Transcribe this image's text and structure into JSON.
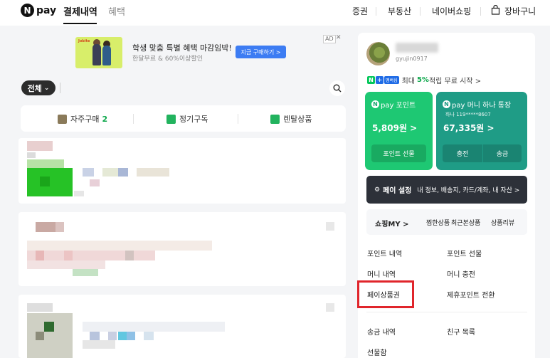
{
  "nav": {
    "logo_letter": "N",
    "logo_text": "pay",
    "tabs": [
      {
        "label": "결제내역",
        "active": true
      },
      {
        "label": "혜택",
        "active": false
      }
    ],
    "right": [
      "증권",
      "부동산",
      "네이버쇼핑",
      "장바구니"
    ]
  },
  "ad": {
    "brand": "Jobite",
    "title": "학생 맞춤 특별 혜택 마감임박!",
    "subtitle": "한달무료 & 60%이상할인",
    "button": "지금 구매하기 >",
    "tag": "AD",
    "close": "✕"
  },
  "filter": {
    "label": "전체",
    "chevron": "⌄"
  },
  "categories": [
    {
      "label": "자주구매",
      "count": "2",
      "icon": "frequent-purchase-icon"
    },
    {
      "label": "정기구독",
      "icon": "subscription-icon"
    },
    {
      "label": "렌탈상품",
      "icon": "rental-icon"
    }
  ],
  "user": {
    "id": "gyujin0917"
  },
  "promo": {
    "n": "N",
    "plus": "+",
    "membership": "멤버십",
    "prefix": "최대",
    "pct": "5%",
    "suffix": "적립 무료 시작 >"
  },
  "point_card": {
    "title": "pay 포인트",
    "amount": "5,809원 >",
    "button": "포인트 선물"
  },
  "money_card": {
    "title": "pay 머니 하나 통장",
    "account": "하나 119*****8607",
    "amount": "67,335원 >",
    "charge": "충전",
    "send": "송금"
  },
  "settings": {
    "label": "페이 설정",
    "desc": "내 정보, 배송지, 카드/계좌, 내 자산 >"
  },
  "shopping": {
    "my": "쇼핑MY >",
    "items": [
      "찜한상품",
      "최근본상품",
      "상품리뷰"
    ]
  },
  "menu": {
    "row1": [
      "포인트 내역",
      "포인트 선물"
    ],
    "row2": [
      "머니 내역",
      "머니 충전"
    ],
    "row3": [
      "페이상품권",
      "제휴포인트 전환"
    ],
    "row4": [
      "송금 내역",
      "친구 목록"
    ],
    "row5": [
      "선물함"
    ]
  },
  "colors": {
    "naver_green": "#03c75a",
    "point_green": "#1ec873",
    "money_teal": "#1f9c86",
    "highlight_red": "#e0252b"
  }
}
